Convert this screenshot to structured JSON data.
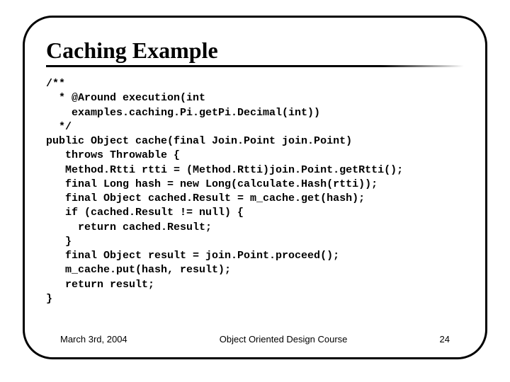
{
  "slide": {
    "title": "Caching Example",
    "code": "/**\n  * @Around execution(int\n    examples.caching.Pi.getPi.Decimal(int))\n  */\npublic Object cache(final Join.Point join.Point)\n   throws Throwable {\n   Method.Rtti rtti = (Method.Rtti)join.Point.getRtti();\n   final Long hash = new Long(calculate.Hash(rtti));\n   final Object cached.Result = m_cache.get(hash);\n   if (cached.Result != null) {\n     return cached.Result;\n   }\n   final Object result = join.Point.proceed();\n   m_cache.put(hash, result);\n   return result;\n}",
    "footer": {
      "date": "March 3rd, 2004",
      "course": "Object Oriented Design Course",
      "page": "24"
    }
  }
}
